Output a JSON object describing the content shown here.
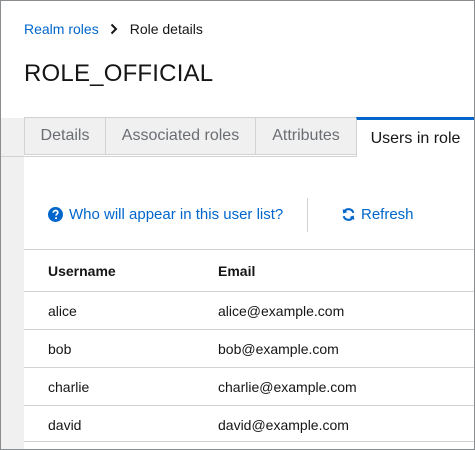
{
  "breadcrumb": {
    "parent": "Realm roles",
    "current": "Role details"
  },
  "page": {
    "title": "ROLE_OFFICIAL"
  },
  "tabs": [
    {
      "label": "Details"
    },
    {
      "label": "Associated roles"
    },
    {
      "label": "Attributes"
    },
    {
      "label": "Users in role",
      "active": true
    }
  ],
  "toolbar": {
    "help_label": "Who will appear in this user list?",
    "refresh_label": "Refresh"
  },
  "table": {
    "columns": [
      "Username",
      "Email"
    ],
    "rows": [
      [
        "alice",
        "alice@example.com"
      ],
      [
        "bob",
        "bob@example.com"
      ],
      [
        "charlie",
        "charlie@example.com"
      ],
      [
        "david",
        "david@example.com"
      ]
    ]
  },
  "colors": {
    "link": "#0066cc",
    "active_tab_border": "#0066cc",
    "tab_bg": "#f0f0f0"
  }
}
